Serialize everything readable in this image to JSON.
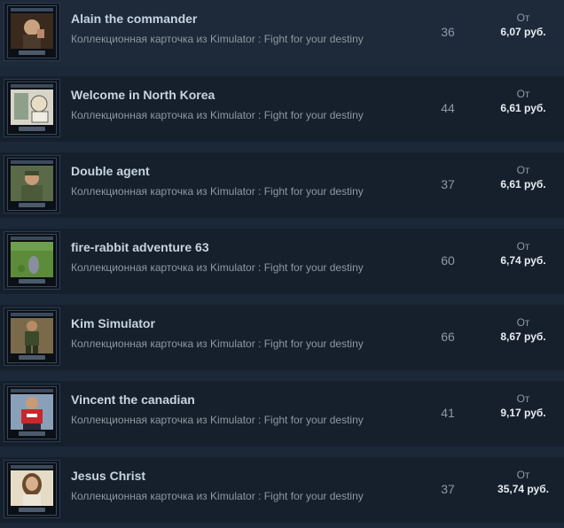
{
  "listings": [
    {
      "name": "Alain the commander",
      "subtitle": "Коллекционная карточка из Kimulator : Fight for your destiny",
      "quantity": "36",
      "from_label": "От",
      "price": "6,07 руб.",
      "art": "portrait-icon"
    },
    {
      "name": "Welcome in North Korea",
      "subtitle": "Коллекционная карточка из Kimulator : Fight for your destiny",
      "quantity": "44",
      "from_label": "От",
      "price": "6,61 руб.",
      "art": "poster-icon"
    },
    {
      "name": "Double agent",
      "subtitle": "Коллекционная карточка из Kimulator : Fight for your destiny",
      "quantity": "37",
      "from_label": "От",
      "price": "6,61 руб.",
      "art": "soldier-icon"
    },
    {
      "name": "fire-rabbit adventure 63",
      "subtitle": "Коллекционная карточка из Kimulator : Fight for your destiny",
      "quantity": "60",
      "from_label": "От",
      "price": "6,74 руб.",
      "art": "field-icon"
    },
    {
      "name": "Kim Simulator",
      "subtitle": "Коллекционная карточка из Kimulator : Fight for your destiny",
      "quantity": "66",
      "from_label": "От",
      "price": "8,67 руб.",
      "art": "figure-icon"
    },
    {
      "name": "Vincent the canadian",
      "subtitle": "Коллекционная карточка из Kimulator : Fight for your destiny",
      "quantity": "41",
      "from_label": "От",
      "price": "9,17 руб.",
      "art": "red-shirt-icon"
    },
    {
      "name": "Jesus Christ",
      "subtitle": "Коллекционная карточка из Kimulator : Fight for your destiny",
      "quantity": "37",
      "from_label": "От",
      "price": "35,74 руб.",
      "art": "bearded-portrait-icon"
    }
  ]
}
